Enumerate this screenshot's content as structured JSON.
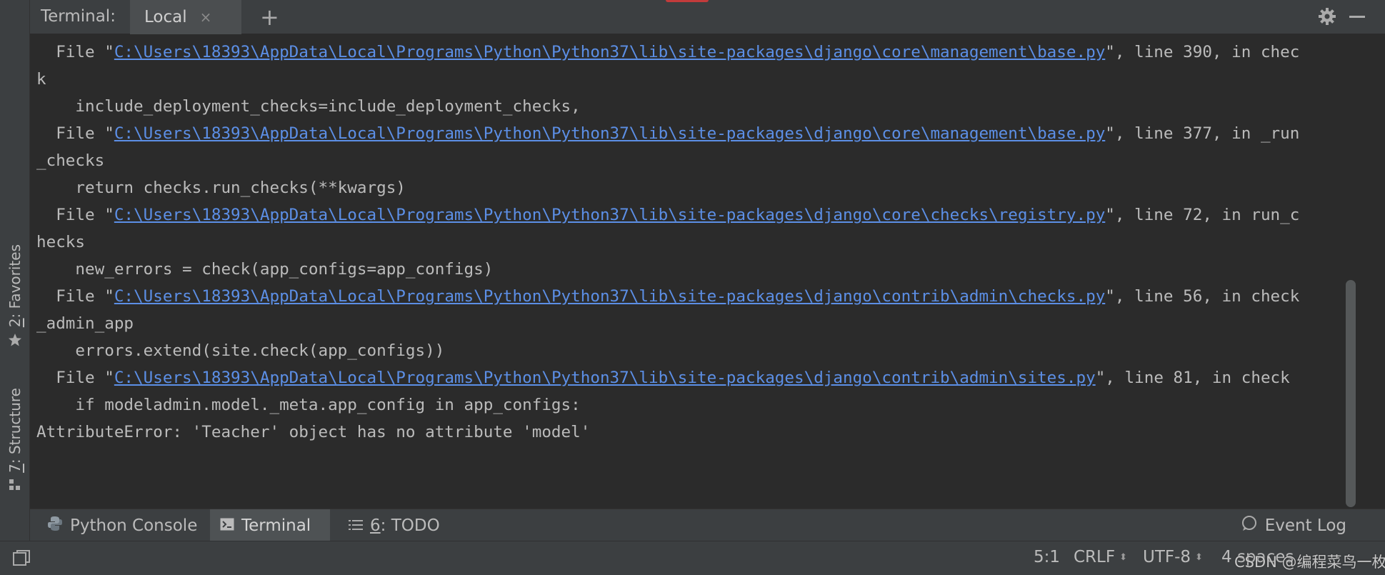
{
  "header": {
    "title": "Terminal:",
    "active_tab": "Local",
    "close_glyph": "×",
    "add_glyph": "+"
  },
  "side_tabs": {
    "favorites": {
      "number": "2",
      "label": ": Favorites",
      "icon": "star-icon"
    },
    "structure": {
      "number": "7",
      "label": ": Structure",
      "icon": "structure-icon"
    }
  },
  "terminal": {
    "lines": [
      {
        "pre": "  File \"",
        "link": "C:\\Users\\18393\\AppData\\Local\\Programs\\Python\\Python37\\lib\\site-packages\\django\\core\\management\\base.py",
        "post": "\", line 390, in chec"
      },
      {
        "pre": "k",
        "link": "",
        "post": ""
      },
      {
        "pre": "    include_deployment_checks=include_deployment_checks,",
        "link": "",
        "post": ""
      },
      {
        "pre": "  File \"",
        "link": "C:\\Users\\18393\\AppData\\Local\\Programs\\Python\\Python37\\lib\\site-packages\\django\\core\\management\\base.py",
        "post": "\", line 377, in _run"
      },
      {
        "pre": "_checks",
        "link": "",
        "post": ""
      },
      {
        "pre": "    return checks.run_checks(**kwargs)",
        "link": "",
        "post": ""
      },
      {
        "pre": "  File \"",
        "link": "C:\\Users\\18393\\AppData\\Local\\Programs\\Python\\Python37\\lib\\site-packages\\django\\core\\checks\\registry.py",
        "post": "\", line 72, in run_c"
      },
      {
        "pre": "hecks",
        "link": "",
        "post": ""
      },
      {
        "pre": "    new_errors = check(app_configs=app_configs)",
        "link": "",
        "post": ""
      },
      {
        "pre": "  File \"",
        "link": "C:\\Users\\18393\\AppData\\Local\\Programs\\Python\\Python37\\lib\\site-packages\\django\\contrib\\admin\\checks.py",
        "post": "\", line 56, in check"
      },
      {
        "pre": "_admin_app",
        "link": "",
        "post": ""
      },
      {
        "pre": "    errors.extend(site.check(app_configs))",
        "link": "",
        "post": ""
      },
      {
        "pre": "  File \"",
        "link": "C:\\Users\\18393\\AppData\\Local\\Programs\\Python\\Python37\\lib\\site-packages\\django\\contrib\\admin\\sites.py",
        "post": "\", line 81, in check"
      },
      {
        "pre": "    if modeladmin.model._meta.app_config in app_configs:",
        "link": "",
        "post": ""
      },
      {
        "pre": "AttributeError: 'Teacher' object has no attribute 'model'",
        "link": "",
        "post": ""
      }
    ]
  },
  "tool_tabs": {
    "python_console": "Python Console",
    "terminal": "Terminal",
    "todo_number": "6",
    "todo_label": ": TODO",
    "event_log": "Event Log"
  },
  "status_bar": {
    "position": "5:1",
    "line_separator": "CRLF",
    "encoding": "UTF-8",
    "indent": "4 spaces",
    "watermark": "CSDN @编程菜鸟一枚"
  },
  "colors": {
    "background": "#2b2b2b",
    "panel": "#3c3f41",
    "link": "#5c8fe6",
    "text": "#bbbbbb"
  }
}
